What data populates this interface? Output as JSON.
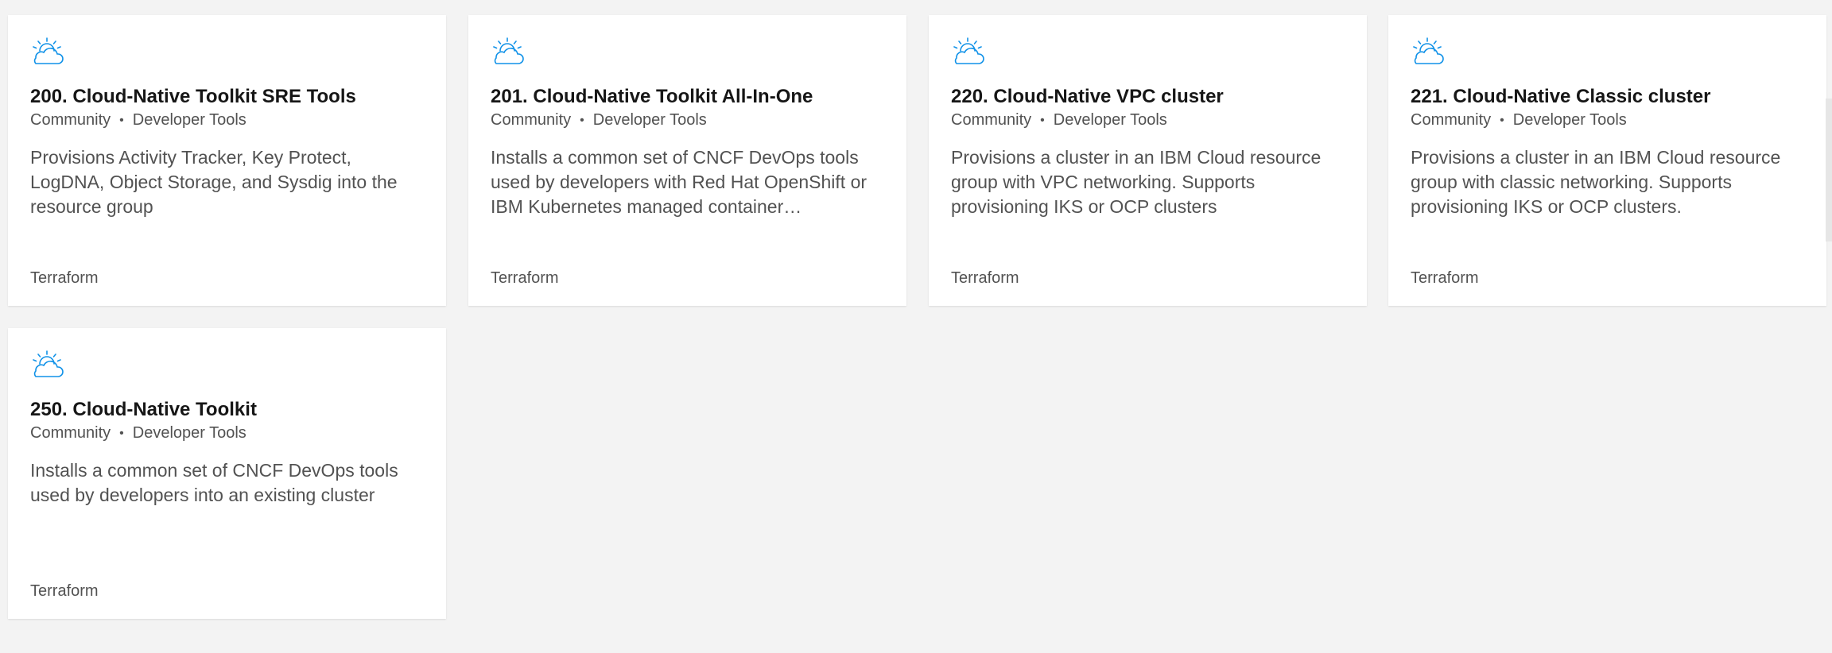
{
  "icon_color": "#1192e8",
  "cards": [
    {
      "title": "200. Cloud-Native Toolkit SRE Tools",
      "provider": "Community",
      "category": "Developer Tools",
      "description": "Provisions Activity Tracker, Key Protect, LogDNA, Object Storage, and Sysdig into the resource group",
      "type": "Terraform",
      "icon": "cloud-sun-icon"
    },
    {
      "title": "201. Cloud-Native Toolkit All-In-One",
      "provider": "Community",
      "category": "Developer Tools",
      "description": "Installs a common set of CNCF DevOps tools used by developers with Red Hat OpenShift or IBM Kubernetes managed container…",
      "type": "Terraform",
      "icon": "cloud-sun-icon"
    },
    {
      "title": "220. Cloud-Native VPC cluster",
      "provider": "Community",
      "category": "Developer Tools",
      "description": "Provisions a cluster in an IBM Cloud resource group with VPC networking. Supports provisioning IKS or OCP clusters",
      "type": "Terraform",
      "icon": "cloud-sun-icon"
    },
    {
      "title": "221. Cloud-Native Classic cluster",
      "provider": "Community",
      "category": "Developer Tools",
      "description": "Provisions a cluster in an IBM Cloud resource group with classic networking. Supports provisioning IKS or OCP clusters.",
      "type": "Terraform",
      "icon": "cloud-sun-icon"
    },
    {
      "title": "250. Cloud-Native Toolkit",
      "provider": "Community",
      "category": "Developer Tools",
      "description": "Installs a common set of CNCF DevOps tools used by developers into an existing cluster",
      "type": "Terraform",
      "icon": "cloud-sun-icon"
    }
  ]
}
